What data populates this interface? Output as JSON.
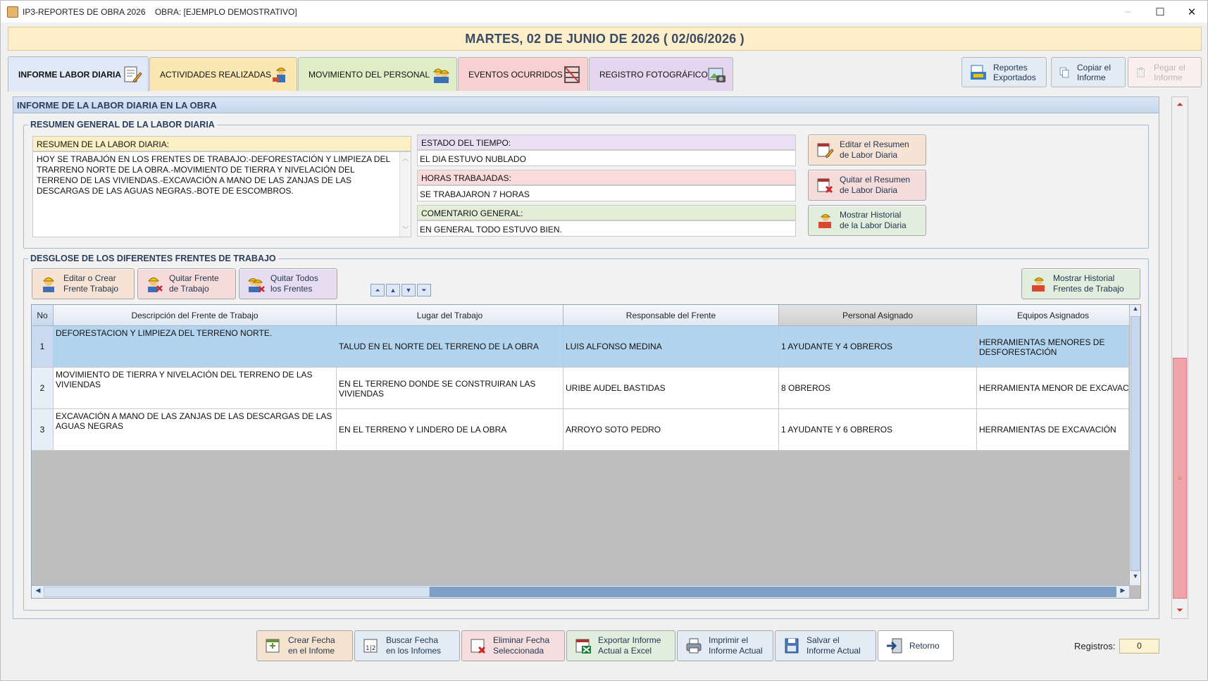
{
  "window": {
    "title": "IP3-REPORTES DE OBRA 2026    OBRA: [EJEMPLO DEMOSTRATIVO]",
    "minimize": "–",
    "maximize": "☐",
    "close": "✕"
  },
  "banner": {
    "date_text": "MARTES, 02 DE JUNIO DE 2026  ( 02/06/2026 )"
  },
  "tabs": [
    {
      "label": "INFORME LABOR DIARIA",
      "icon": "notepad-pencil-icon",
      "color": "#dfe9f7"
    },
    {
      "label": "ACTIVIDADES REALIZADAS",
      "icon": "worker-tools-icon",
      "color": "#fbe7b2"
    },
    {
      "label": "MOVIMIENTO DEL PERSONAL",
      "icon": "workers-group-icon",
      "color": "#dfeec6"
    },
    {
      "label": "EVENTOS OCURRIDOS",
      "icon": "scaffold-icon",
      "color": "#fad1d3"
    },
    {
      "label": "REGISTRO FOTOGRÁFICO",
      "icon": "photo-camera-icon",
      "color": "#e6d5ef"
    }
  ],
  "top_right_buttons": [
    {
      "label": "Reportes Exportados",
      "line1": "Reportes",
      "line2": "Exportados",
      "icon": "exported-reports-icon",
      "enabled": true
    },
    {
      "label": "Copiar el Informe",
      "line1": "Copiar el",
      "line2": "Informe",
      "icon": "copy-icon",
      "enabled": true
    },
    {
      "label": "Pegar el Informe",
      "line1": "Pegar el",
      "line2": "Informe",
      "icon": "paste-icon",
      "enabled": false
    }
  ],
  "main_panel": {
    "title": "INFORME DE LA LABOR DIARIA EN LA OBRA"
  },
  "summary": {
    "legend": "RESUMEN GENERAL DE LA LABOR DIARIA",
    "memo_label": "RESUMEN DE LA LABOR DIARIA:",
    "memo_text": "HOY SE TRABAJÓN EN LOS FRENTES DE TRABAJO:-DEFORESTACIÓN Y LIMPIEZA DEL TRARRENO NORTE DE LA OBRA.-MOVIMIENTO DE TIERRA Y NIVELACIÓN DEL TERRENO DE LAS VIVIENDAS.-EXCAVACIÓN A MANO DE LAS ZANJAS DE LAS DESCARGAS DE LAS AGUAS NEGRAS.-BOTE DE ESCOMBROS.",
    "weather_label": "ESTADO DEL TIEMPO:",
    "weather_value": "EL DIA ESTUVO NUBLADO",
    "hours_label": "HORAS TRABAJADAS:",
    "hours_value": "SE TRABAJARON 7 HORAS",
    "comment_label": "COMENTARIO GENERAL:",
    "comment_value": "EN GENERAL TODO ESTUVO BIEN.",
    "buttons": [
      {
        "line1": "Editar el Resumen",
        "line2": "de Labor Diaria"
      },
      {
        "line1": "Quitar el Resumen",
        "line2": "de Labor Diaria"
      },
      {
        "line1": "Mostrar Historial",
        "line2": "de la Labor Diaria"
      }
    ]
  },
  "fronts": {
    "legend": "DESGLOSE DE LOS DIFERENTES FRENTES DE TRABAJO",
    "buttons": [
      {
        "line1": "Editar o Crear",
        "line2": "Frente Trabajo"
      },
      {
        "line1": "Quitar Frente",
        "line2": "de Trabajo"
      },
      {
        "line1": "Quitar Todos",
        "line2": "los Frentes"
      }
    ],
    "history_button": {
      "line1": "Mostrar Historial",
      "line2": "Frentes de Trabajo"
    },
    "nav": {
      "first": "⏶",
      "up": "▲",
      "down": "▼",
      "last": "⏷"
    },
    "columns": [
      "No",
      "Descripción del Frente de Trabajo",
      "Lugar del Trabajo",
      "Responsable del Frente",
      "Personal Asignado",
      "Equipos Asignados"
    ],
    "rows": [
      {
        "no": "1",
        "desc": "DEFORESTACION Y LIMPIEZA DEL TERRENO NORTE.",
        "place": "TALUD EN EL NORTE DEL TERRENO DE LA OBRA",
        "resp": "LUIS ALFONSO MEDINA",
        "staff": "1 AYUDANTE Y 4 OBREROS",
        "equip": "HERRAMIENTAS MENORES DE DESFORESTACIÓN",
        "selected": true
      },
      {
        "no": "2",
        "desc": "MOVIMIENTO DE TIERRA Y NIVELACIÓN DEL TERRENO DE LAS VIVIENDAS",
        "place": "EN EL TERRENO DONDE SE CONSTRUIRAN LAS VIVIENDAS",
        "resp": "URIBE AUDEL BASTIDAS",
        "staff": "8 OBREROS",
        "equip": "HERRAMIENTA MENOR DE EXCAVACIÓN",
        "selected": false
      },
      {
        "no": "3",
        "desc": "EXCAVACIÓN A MANO DE LAS ZANJAS DE LAS DESCARGAS DE LAS AGUAS NEGRAS",
        "place": "EN EL TERRENO Y LINDERO DE LA OBRA",
        "resp": "ARROYO SOTO PEDRO",
        "staff": "1 AYUDANTE Y 6 OBREROS",
        "equip": "HERRAMIENTAS DE EXCAVACIÓN",
        "selected": false
      }
    ]
  },
  "bottom_buttons": [
    {
      "line1": "Crear Fecha",
      "line2": "en el Infome",
      "color": "#f6e3cf"
    },
    {
      "line1": "Buscar Fecha",
      "line2": "en los Infomes",
      "color": "#e3ebf5"
    },
    {
      "line1": "Eliminar Fecha",
      "line2": "Seleccionada",
      "color": "#f6dede"
    },
    {
      "line1": "Exportar Informe",
      "line2": "Actual a Excel",
      "color": "#e2eedd"
    },
    {
      "line1": "Imprimir el",
      "line2": "Informe Actual",
      "color": "#e3ebf5"
    },
    {
      "line1": "Salvar el",
      "line2": "Informe Actual",
      "color": "#e3ebf5"
    },
    {
      "line1": "Retorno",
      "line2": "",
      "color": "#ffffff"
    }
  ],
  "records": {
    "label": "Registros:",
    "value": "0"
  }
}
